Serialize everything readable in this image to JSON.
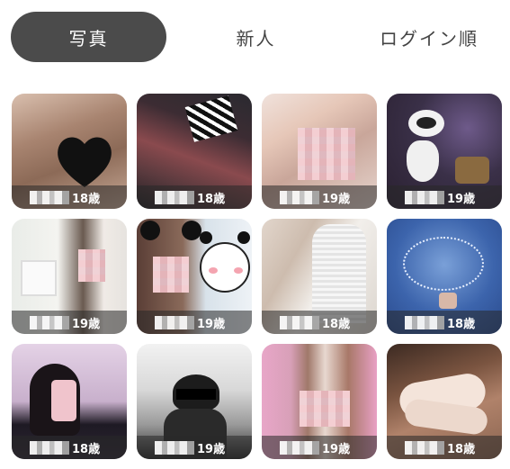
{
  "tabs": [
    {
      "label": "写真",
      "active": true
    },
    {
      "label": "新人",
      "active": false
    },
    {
      "label": "ログイン順",
      "active": false
    }
  ],
  "profiles": [
    {
      "age": "18歳",
      "photo": "brown-hair-heart"
    },
    {
      "age": "18歳",
      "photo": "dark-hair-fishnet"
    },
    {
      "age": "19歳",
      "photo": "blonde-selfie"
    },
    {
      "age": "19歳",
      "photo": "robot-figure"
    },
    {
      "age": "19歳",
      "photo": "white-dress-room"
    },
    {
      "age": "19歳",
      "photo": "panda-ears-line-bear"
    },
    {
      "age": "18歳",
      "photo": "white-blouse-hand"
    },
    {
      "age": "18歳",
      "photo": "blue-fireworks"
    },
    {
      "age": "18歳",
      "photo": "phone-mirror-selfie"
    },
    {
      "age": "19歳",
      "photo": "monochrome-panda-hat"
    },
    {
      "age": "19歳",
      "photo": "bob-hair-pink"
    },
    {
      "age": "18歳",
      "photo": "hands-closeup"
    }
  ],
  "colors": {
    "tab_active_bg": "#4b4b4b",
    "caption_bg": "rgba(40,40,40,0.55)"
  }
}
